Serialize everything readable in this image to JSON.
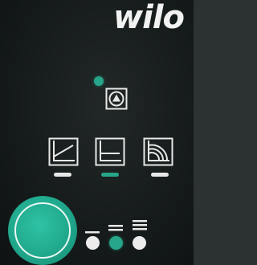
{
  "brand": {
    "logo_text": "wilo"
  },
  "colors": {
    "accent": "#27a58a",
    "panel": "#151a1a",
    "indicator_off": "#ececec"
  },
  "controls": {
    "venting": {
      "icon": "pump-vent-icon",
      "active": true
    },
    "modes": [
      {
        "icon": "variable-differential-pressure-icon",
        "selected": false
      },
      {
        "icon": "constant-differential-pressure-icon",
        "selected": true
      },
      {
        "icon": "constant-speed-icon",
        "selected": false
      }
    ],
    "speed_levels": [
      {
        "icon": "speed-1-icon",
        "selected": false
      },
      {
        "icon": "speed-2-icon",
        "selected": true
      },
      {
        "icon": "speed-3-icon",
        "selected": false
      }
    ],
    "operating_button": {
      "icon": "operating-button"
    }
  }
}
